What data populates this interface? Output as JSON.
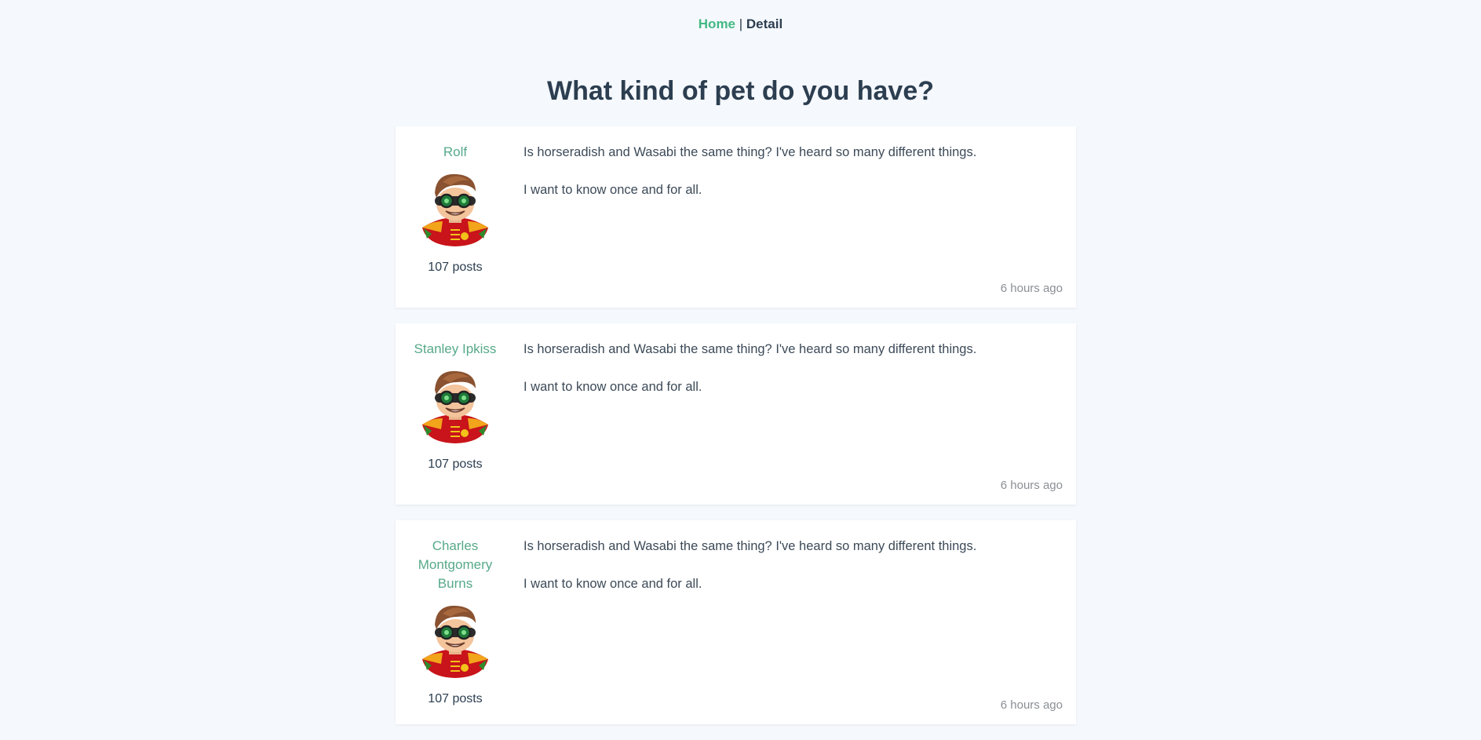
{
  "nav": {
    "home_label": "Home",
    "separator": "|",
    "current_label": "Detail"
  },
  "thread": {
    "title": "What kind of pet do you have?"
  },
  "posts": [
    {
      "user_name": "Rolf",
      "post_count": "107 posts",
      "text_line_1": "Is horseradish and Wasabi the same thing? I've heard so many different things.",
      "text_line_2": "I want to know once and for all.",
      "date": "6 hours ago"
    },
    {
      "user_name": "Stanley Ipkiss",
      "post_count": "107 posts",
      "text_line_1": "Is horseradish and Wasabi the same thing? I've heard so many different things.",
      "text_line_2": "I want to know once and for all.",
      "date": "6 hours ago"
    },
    {
      "user_name": "Charles Montgomery Burns",
      "post_count": "107 posts",
      "text_line_1": "Is horseradish and Wasabi the same thing? I've heard so many different things.",
      "text_line_2": "I want to know once and for all.",
      "date": "6 hours ago"
    }
  ],
  "colors": {
    "accent": "#42b983",
    "username": "#57a98a",
    "text": "#2c3e50",
    "background": "#f5f8fd",
    "card": "#ffffff",
    "muted": "#8a8f94"
  },
  "icons": {
    "avatar": "robin-lego-avatar-icon"
  }
}
